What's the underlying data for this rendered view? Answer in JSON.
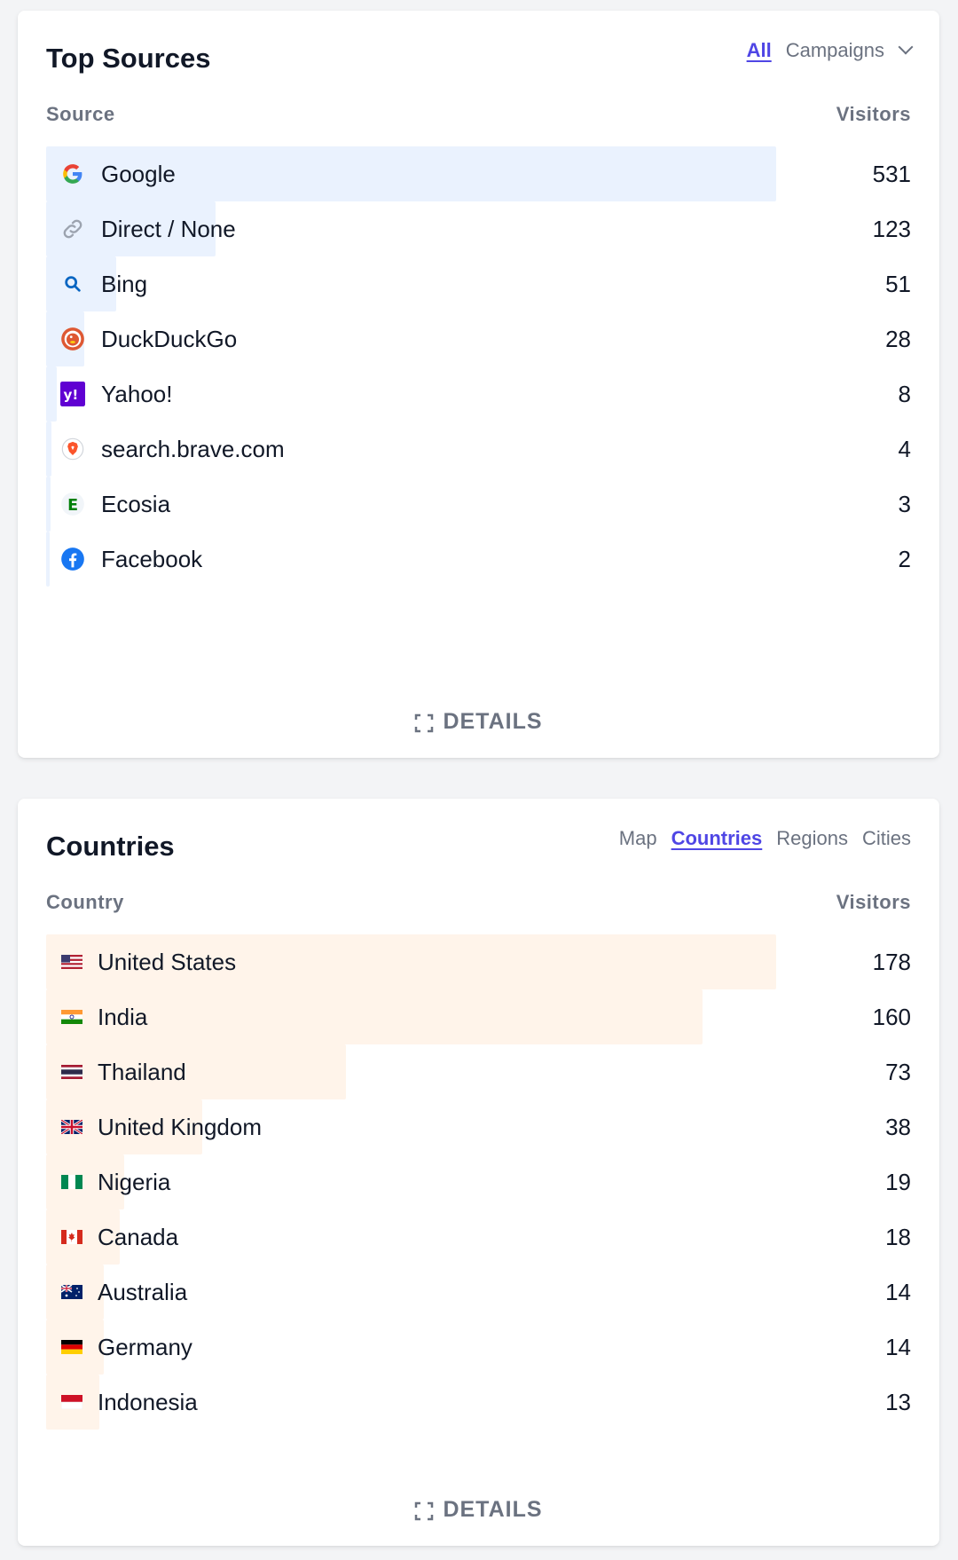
{
  "sources": {
    "title": "Top Sources",
    "switcher": {
      "all": "All",
      "campaigns": "Campaigns"
    },
    "col_source": "Source",
    "col_visitors": "Visitors",
    "details": "DETAILS",
    "max": 531,
    "items": [
      {
        "label": "Google",
        "value": "531",
        "visitors": 531,
        "icon": "google-icon"
      },
      {
        "label": "Direct / None",
        "value": "123",
        "visitors": 123,
        "icon": "link-icon"
      },
      {
        "label": "Bing",
        "value": "51",
        "visitors": 51,
        "icon": "bing-icon"
      },
      {
        "label": "DuckDuckGo",
        "value": "28",
        "visitors": 28,
        "icon": "duckduckgo-icon"
      },
      {
        "label": "Yahoo!",
        "value": "8",
        "visitors": 8,
        "icon": "yahoo-icon"
      },
      {
        "label": "search.brave.com",
        "value": "4",
        "visitors": 4,
        "icon": "brave-icon"
      },
      {
        "label": "Ecosia",
        "value": "3",
        "visitors": 3,
        "icon": "ecosia-icon"
      },
      {
        "label": "Facebook",
        "value": "2",
        "visitors": 2,
        "icon": "facebook-icon"
      }
    ]
  },
  "countries": {
    "title": "Countries",
    "tabs": {
      "map": "Map",
      "countries": "Countries",
      "regions": "Regions",
      "cities": "Cities"
    },
    "col_country": "Country",
    "col_visitors": "Visitors",
    "details": "DETAILS",
    "max": 178,
    "items": [
      {
        "label": "United States",
        "value": "178",
        "visitors": 178,
        "flag": "us-flag-icon"
      },
      {
        "label": "India",
        "value": "160",
        "visitors": 160,
        "flag": "india-flag-icon"
      },
      {
        "label": "Thailand",
        "value": "73",
        "visitors": 73,
        "flag": "thailand-flag-icon"
      },
      {
        "label": "United Kingdom",
        "value": "38",
        "visitors": 38,
        "flag": "uk-flag-icon"
      },
      {
        "label": "Nigeria",
        "value": "19",
        "visitors": 19,
        "flag": "nigeria-flag-icon"
      },
      {
        "label": "Canada",
        "value": "18",
        "visitors": 18,
        "flag": "canada-flag-icon"
      },
      {
        "label": "Australia",
        "value": "14",
        "visitors": 14,
        "flag": "australia-flag-icon"
      },
      {
        "label": "Germany",
        "value": "14",
        "visitors": 14,
        "flag": "germany-flag-icon"
      },
      {
        "label": "Indonesia",
        "value": "13",
        "visitors": 13,
        "flag": "indonesia-flag-icon"
      }
    ]
  }
}
